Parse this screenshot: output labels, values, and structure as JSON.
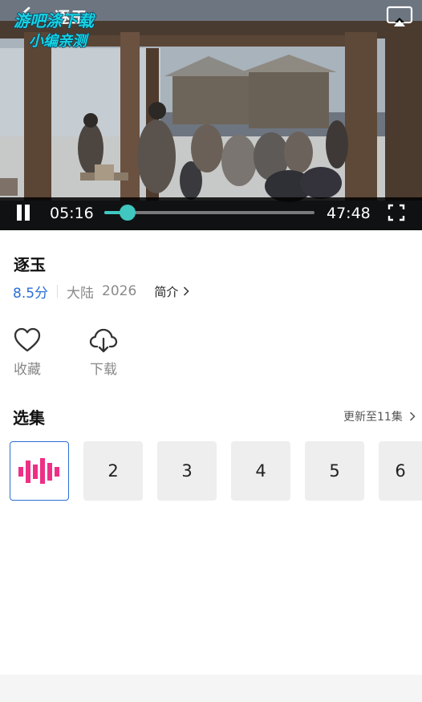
{
  "player": {
    "title": "逐玉",
    "watermark_line1": "游吧涤下载",
    "watermark_line2": "小编亲测",
    "current_time": "05:16",
    "total_time": "47:48",
    "progress_fraction": 0.11,
    "accent_color": "#3fc7c0"
  },
  "show": {
    "title": "逐玉",
    "rating": "8.5分",
    "region": "大陆",
    "year": "2026",
    "intro_label": "简介"
  },
  "actions": [
    {
      "label": "收藏",
      "icon": "heart-icon"
    },
    {
      "label": "下载",
      "icon": "cloud-download-icon"
    }
  ],
  "episodes_section": {
    "title": "选集",
    "update_text": "更新至11集",
    "items": [
      "",
      "2",
      "3",
      "4",
      "5",
      "6"
    ],
    "playing_index": 0,
    "playing_icon": "equalizer-icon",
    "playing_color": "#ee2f86"
  }
}
